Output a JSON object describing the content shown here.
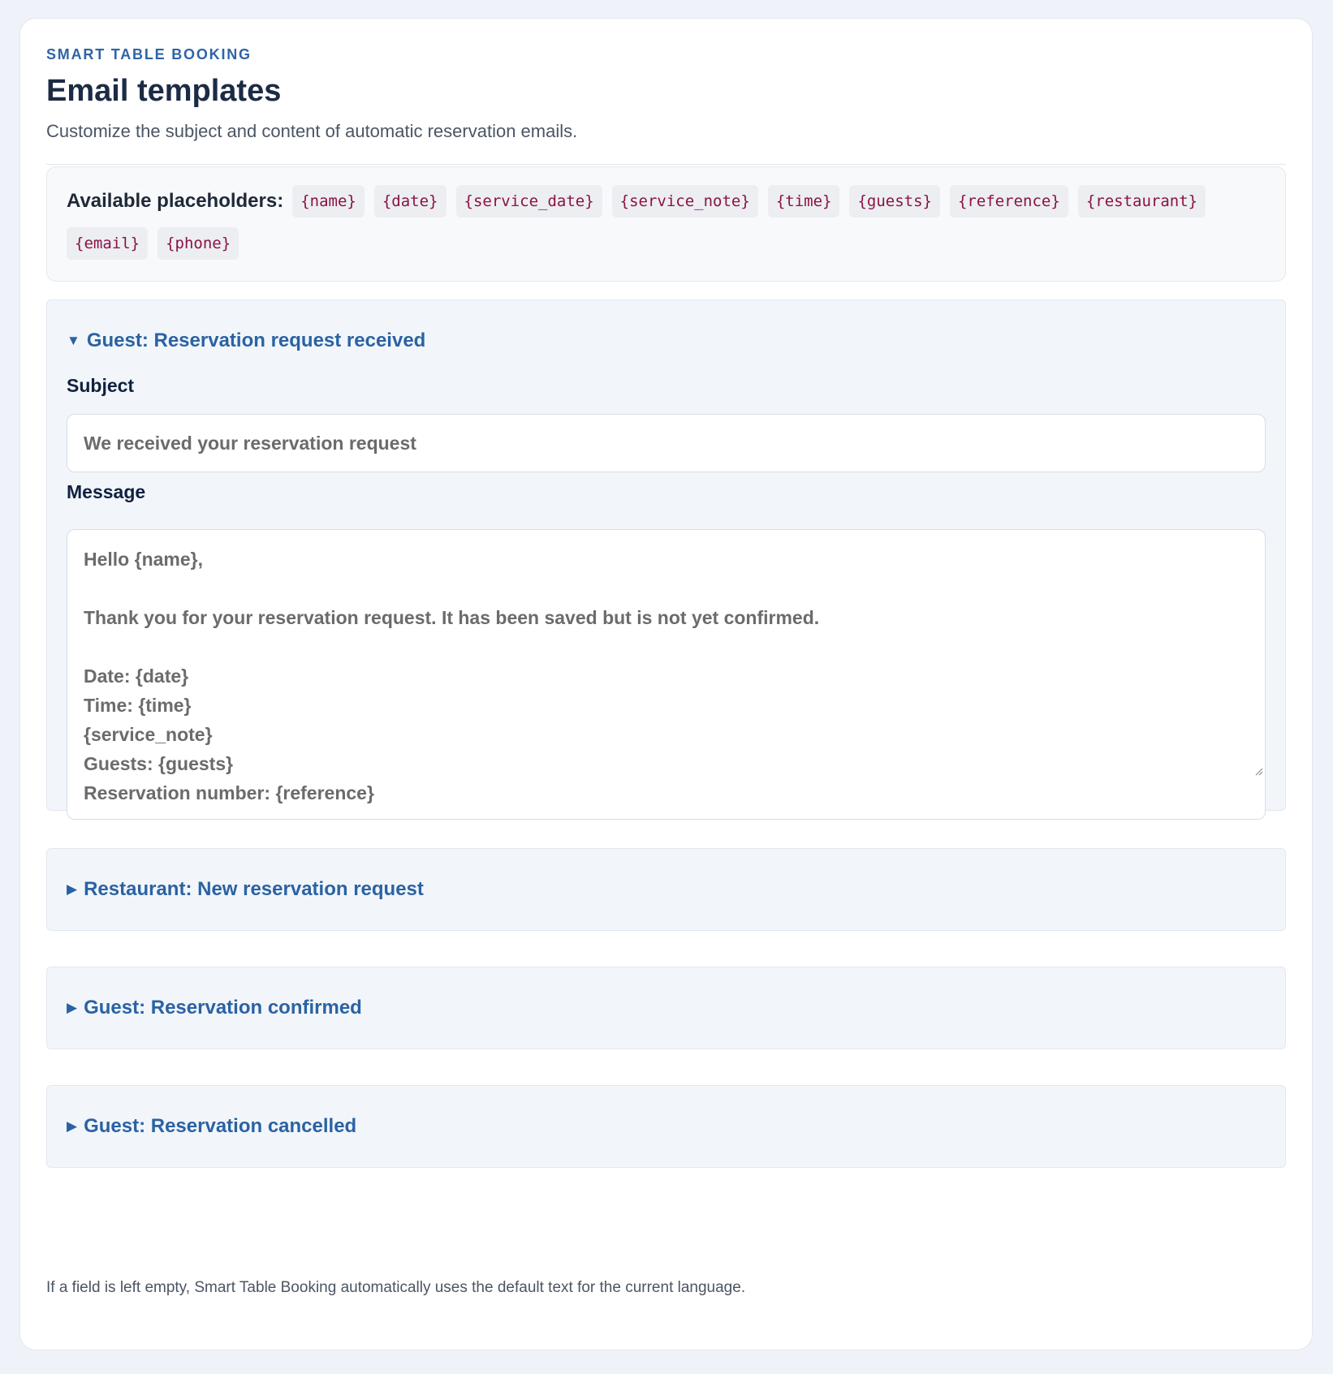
{
  "header": {
    "eyebrow": "SMART TABLE BOOKING",
    "title": "Email templates",
    "subtitle": "Customize the subject and content of automatic reservation emails."
  },
  "placeholders": {
    "label": "Available placeholders:",
    "items": [
      "{name}",
      "{date}",
      "{service_date}",
      "{service_note}",
      "{time}",
      "{guests}",
      "{reference}",
      "{restaurant}",
      "{email}",
      "{phone}"
    ]
  },
  "templates": [
    {
      "summary": "Guest: Reservation request received",
      "expanded": true,
      "subject_label": "Subject",
      "subject_value": "We received your reservation request",
      "message_label": "Message",
      "message_value": "Hello {name},\n\nThank you for your reservation request. It has been saved but is not yet confirmed.\n\nDate: {date}\nTime: {time}\n{service_note}\nGuests: {guests}\nReservation number: {reference}"
    },
    {
      "summary": "Restaurant: New reservation request",
      "expanded": false
    },
    {
      "summary": "Guest: Reservation confirmed",
      "expanded": false
    },
    {
      "summary": "Guest: Reservation cancelled",
      "expanded": false
    }
  ],
  "footnote": "If a field is left empty, Smart Table Booking automatically uses the default text for the current language.",
  "icons": {
    "expanded": "triangle-down-icon",
    "collapsed": "triangle-right-icon"
  },
  "colors": {
    "accent": "#2b62a3",
    "placeholder_code": "#8a1245",
    "page_bg": "#eff3f9",
    "section_bg": "#f2f6fa"
  }
}
